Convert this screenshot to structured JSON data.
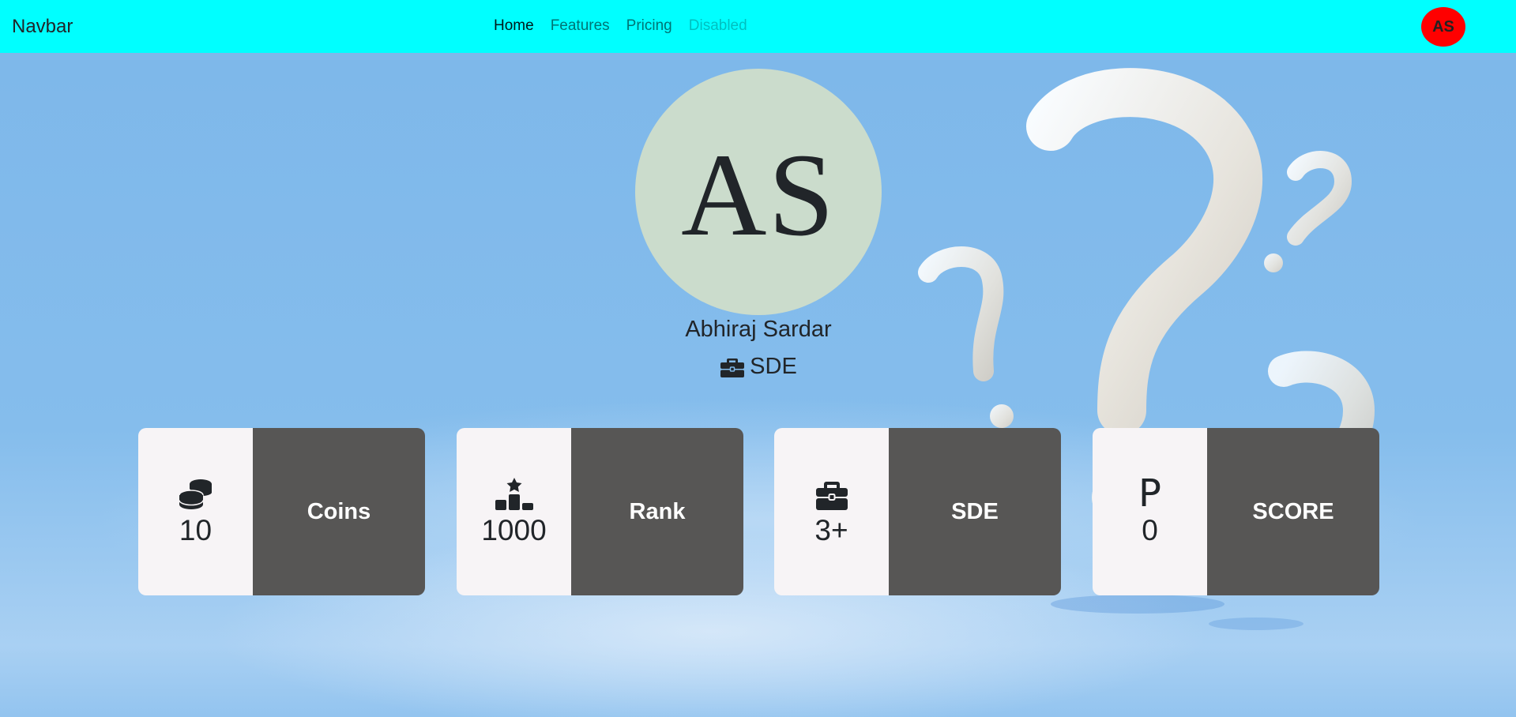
{
  "navbar": {
    "brand": "Navbar",
    "links": [
      {
        "label": "Home",
        "state": "active"
      },
      {
        "label": "Features",
        "state": "normal"
      },
      {
        "label": "Pricing",
        "state": "normal"
      },
      {
        "label": "Disabled",
        "state": "disabled"
      }
    ],
    "avatar_initials": "AS",
    "avatar_color": "#ff0000",
    "background_color": "#00ffff"
  },
  "profile": {
    "initials": "AS",
    "name": "Abhiraj Sardar",
    "role": "SDE",
    "role_icon": "briefcase-icon",
    "avatar_color": "#cbdccc"
  },
  "stats": [
    {
      "icon": "coins-icon",
      "value": "10",
      "label": "Coins"
    },
    {
      "icon": "ranking-podium-icon",
      "value": "1000",
      "label": "Rank"
    },
    {
      "icon": "briefcase-icon",
      "value": "3+",
      "label": "SDE"
    },
    {
      "icon": "p-letter-icon",
      "icon_text": "P",
      "value": "0",
      "label": "SCORE"
    }
  ],
  "colors": {
    "card_left": "#f7f4f6",
    "card_right": "#575655",
    "page_background": "#7fb8ea"
  }
}
